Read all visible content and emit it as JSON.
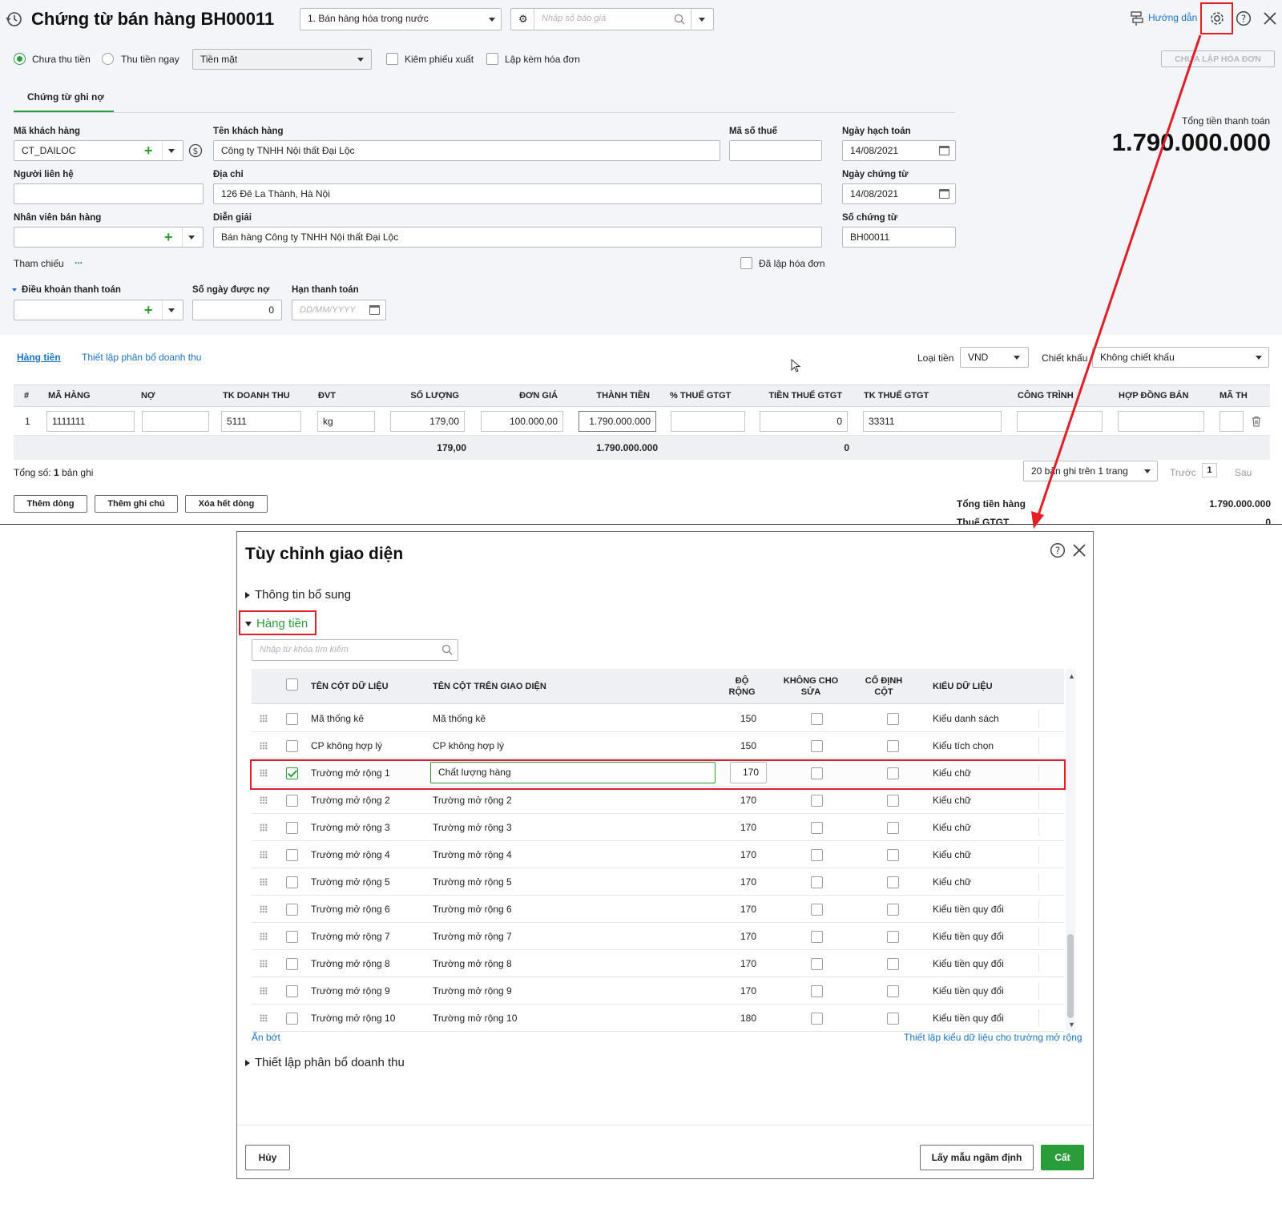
{
  "voucher": {
    "title": "Chứng từ bán hàng BH00011",
    "sale_type": "1. Bán hàng hóa trong nước",
    "quote_placeholder": "Nhập số báo giá",
    "guide_label": "Hướng dẫn",
    "radio_unpaid": "Chưa thu tiền",
    "radio_paid": "Thu tiền ngay",
    "payment_method": "Tiền mặt",
    "cb_export": "Kiêm phiếu xuất",
    "cb_invoice": "Lập kèm hóa đơn",
    "not_invoiced_btn": "CHƯA LẬP HÓA ĐƠN",
    "tab_debt": "Chứng từ ghi nợ",
    "total_label": "Tổng tiền thanh toán",
    "total_value": "1.790.000.000",
    "form": {
      "customer_code_label": "Mã khách hàng",
      "customer_code": "CT_DAILOC",
      "customer_name_label": "Tên khách hàng",
      "customer_name": "Công ty TNHH Nội thất Đại Lộc",
      "tax_code_label": "Mã số thuế",
      "posting_date_label": "Ngày hạch toán",
      "posting_date": "14/08/2021",
      "contact_label": "Người liên hệ",
      "address_label": "Địa chỉ",
      "address": "126 Đê La Thành, Hà Nội",
      "voucher_date_label": "Ngày chứng từ",
      "voucher_date": "14/08/2021",
      "salesperson_label": "Nhân viên bán hàng",
      "description_label": "Diễn giải",
      "description": "Bán hàng Công ty TNHH Nội thất Đại Lộc",
      "voucher_no_label": "Số chứng từ",
      "voucher_no": "BH00011",
      "reference_label": "Tham chiếu",
      "reference_more": "...",
      "invoiced_label": "Đã lập hóa đơn",
      "terms_label": "Điều khoản thanh toán",
      "debt_days_label": "Số ngày được nợ",
      "debt_days": "0",
      "due_date_label": "Hạn thanh toán",
      "due_date_placeholder": "DD/MM/YYYY"
    },
    "grid": {
      "tab_goods": "Hàng tiền",
      "tab_revenue": "Thiết lập phân bổ doanh thu",
      "currency_label": "Loại tiền",
      "currency": "VND",
      "discount_label": "Chiết khấu",
      "discount": "Không chiết khấu",
      "headers": [
        "#",
        "MÃ HÀNG",
        "NỢ",
        "TK DOANH THU",
        "ĐVT",
        "SỐ LƯỢNG",
        "ĐƠN GIÁ",
        "THÀNH TIỀN",
        "% THUẾ GTGT",
        "TIỀN THUẾ GTGT",
        "TK THUẾ GTGT",
        "CÔNG TRÌNH",
        "HỢP ĐỒNG BÁN",
        "MÃ TH"
      ],
      "row": {
        "no": "1",
        "item_code": "1111111",
        "debit": "",
        "revenue_account": "5111",
        "unit": "kg",
        "quantity": "179,00",
        "unit_price": "100.000,00",
        "amount": "1.790.000.000",
        "vat_rate": "",
        "vat_amount": "0",
        "vat_account": "33311"
      },
      "totals": {
        "quantity": "179,00",
        "amount": "1.790.000.000",
        "vat": "0"
      },
      "count_prefix": "Tổng số:",
      "count_value": "1",
      "count_suffix": "bản ghi",
      "pager": "20 bản ghi trên 1 trang",
      "prev": "Trước",
      "page": "1",
      "next": "Sau",
      "add_row": "Thêm dòng",
      "add_note": "Thêm ghi chú",
      "delete_all": "Xóa hết dòng",
      "sum_goods_label": "Tổng tiền hàng",
      "sum_goods_value": "1.790.000.000",
      "vat_label": "Thuế GTGT",
      "vat_value": "0"
    }
  },
  "dialog": {
    "title": "Tùy chỉnh giao diện",
    "section_extra": "Thông tin bổ sung",
    "section_goods": "Hàng tiền",
    "search_placeholder": "Nhập từ khóa tìm kiếm",
    "col_data": "TÊN CỘT DỮ LIỆU",
    "col_display": "TÊN CỘT TRÊN GIAO DIỆN",
    "col_width": "ĐỘ RỘNG",
    "col_noedit": "KHÔNG CHO SỬA",
    "col_fixed": "CỐ ĐỊNH CỘT",
    "col_type": "KIỂU DỮ LIỆU",
    "rows": [
      {
        "data": "Mã thống kê",
        "display": "Mã thống kê",
        "width": "150",
        "type": "Kiểu danh sách"
      },
      {
        "data": "CP không hợp lý",
        "display": "CP không hợp lý",
        "width": "150",
        "type": "Kiểu tích chọn"
      },
      {
        "data": "Trường mở rộng 1",
        "display": "Chất lượng hàng",
        "width": "170",
        "type": "Kiểu chữ"
      },
      {
        "data": "Trường mở rộng 2",
        "display": "Trường mở rộng 2",
        "width": "170",
        "type": "Kiểu chữ"
      },
      {
        "data": "Trường mở rộng 3",
        "display": "Trường mở rộng 3",
        "width": "170",
        "type": "Kiểu chữ"
      },
      {
        "data": "Trường mở rộng 4",
        "display": "Trường mở rộng 4",
        "width": "170",
        "type": "Kiểu chữ"
      },
      {
        "data": "Trường mở rộng 5",
        "display": "Trường mở rộng 5",
        "width": "170",
        "type": "Kiểu chữ"
      },
      {
        "data": "Trường mở rộng 6",
        "display": "Trường mở rộng 6",
        "width": "170",
        "type": "Kiểu tiền quy đổi"
      },
      {
        "data": "Trường mở rộng 7",
        "display": "Trường mở rộng 7",
        "width": "170",
        "type": "Kiểu tiền quy đổi"
      },
      {
        "data": "Trường mở rộng 8",
        "display": "Trường mở rộng 8",
        "width": "170",
        "type": "Kiểu tiền quy đổi"
      },
      {
        "data": "Trường mở rộng 9",
        "display": "Trường mở rộng 9",
        "width": "170",
        "type": "Kiểu tiền quy đổi"
      },
      {
        "data": "Trường mở rộng 10",
        "display": "Trường mở rộng 10",
        "width": "180",
        "type": "Kiểu tiền quy đổi"
      }
    ],
    "collapse_link": "Ẩn bớt",
    "setup_link": "Thiết lập kiểu dữ liệu cho trường mở rộng",
    "section_revenue": "Thiết lập phân bổ doanh thu",
    "cancel": "Hủy",
    "default": "Lấy mẫu ngầm định",
    "save": "Cất"
  },
  "colors": {
    "accent_green": "#2a9d3b",
    "link_blue": "#1a73c9",
    "highlight_red": "#e21f26"
  }
}
